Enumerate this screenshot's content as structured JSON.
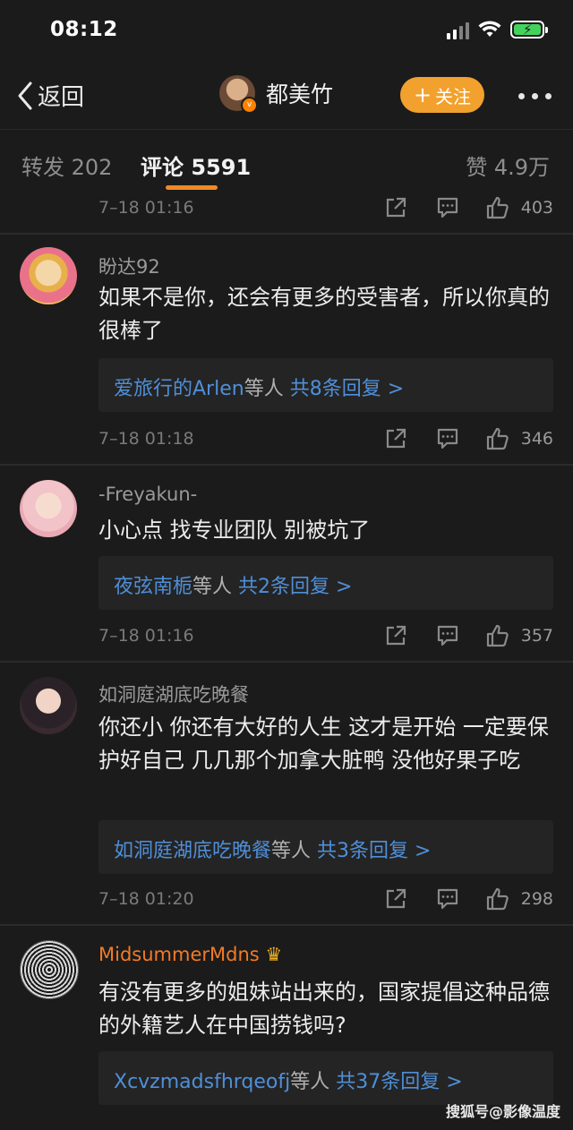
{
  "status": {
    "time": "08:12"
  },
  "nav": {
    "back_label": "返回",
    "user_name": "都美竹",
    "follow_label": "关注"
  },
  "tabs": [
    {
      "label": "转发 202"
    },
    {
      "label": "评论 5591"
    },
    {
      "label": "赞 4.9万"
    }
  ],
  "top_meta": {
    "date": "7–18 01:16",
    "likes": "403"
  },
  "comments": [
    {
      "name": "盼达92",
      "text": "如果不是你，还会有更多的受害者，所以你真的很棒了",
      "reply_users": "爱旅行的Arlen",
      "reply_mid": "等人",
      "reply_count": "共8条回复 >",
      "date": "7–18 01:18",
      "likes": "346"
    },
    {
      "name": "-Freyakun-",
      "text": "小心点 找专业团队 别被坑了",
      "reply_users": "夜弦南栀",
      "reply_mid": "等人",
      "reply_count": "共2条回复 >",
      "date": "7–18 01:16",
      "likes": "357"
    },
    {
      "name": "如洞庭湖底吃晚餐",
      "text": "你还小 你还有大好的人生 这才是开始 一定要保护好自己 几几那个加拿大脏鸭 没他好果子吃",
      "reply_users": "如洞庭湖底吃晚餐",
      "reply_mid": "等人",
      "reply_count": "共3条回复 >",
      "date": "7–18 01:20",
      "likes": "298"
    },
    {
      "name": "MidsummerMdns",
      "text": "有没有更多的姐妹站出来的，国家提倡这种品德的外籍艺人在中国捞钱吗?",
      "reply_users": "Xcvzmadsfhrqeofj",
      "reply_mid": "等人",
      "reply_count": "共37条回复 >"
    }
  ],
  "watermark": "搜狐号@影像温度",
  "colors": {
    "background": "#1b1b1b",
    "accent": "#f2a12e",
    "link": "#4f8fd8",
    "vip_name": "#f47a26"
  }
}
